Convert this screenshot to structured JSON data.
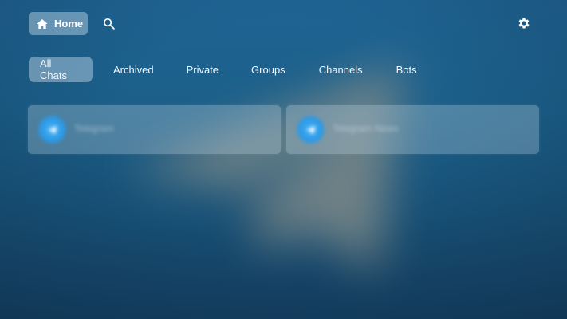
{
  "header": {
    "home_label": "Home",
    "icons": {
      "home": "home-icon",
      "search": "search-icon",
      "settings": "gear-icon"
    }
  },
  "tabs": [
    {
      "label": "All Chats",
      "active": true
    },
    {
      "label": "Archived",
      "active": false
    },
    {
      "label": "Private",
      "active": false
    },
    {
      "label": "Groups",
      "active": false
    },
    {
      "label": "Channels",
      "active": false
    },
    {
      "label": "Bots",
      "active": false
    }
  ],
  "chats": [
    {
      "title": "Telegram",
      "avatar_icon": "telegram-icon"
    },
    {
      "title": "Telegram News",
      "avatar_icon": "telegram-icon"
    }
  ],
  "colors": {
    "background_top": "#1f6494",
    "background_bottom": "#143f61",
    "accent_avatar": "#2a9ae8",
    "chip_fill": "rgba(200,220,235,0.45)"
  }
}
